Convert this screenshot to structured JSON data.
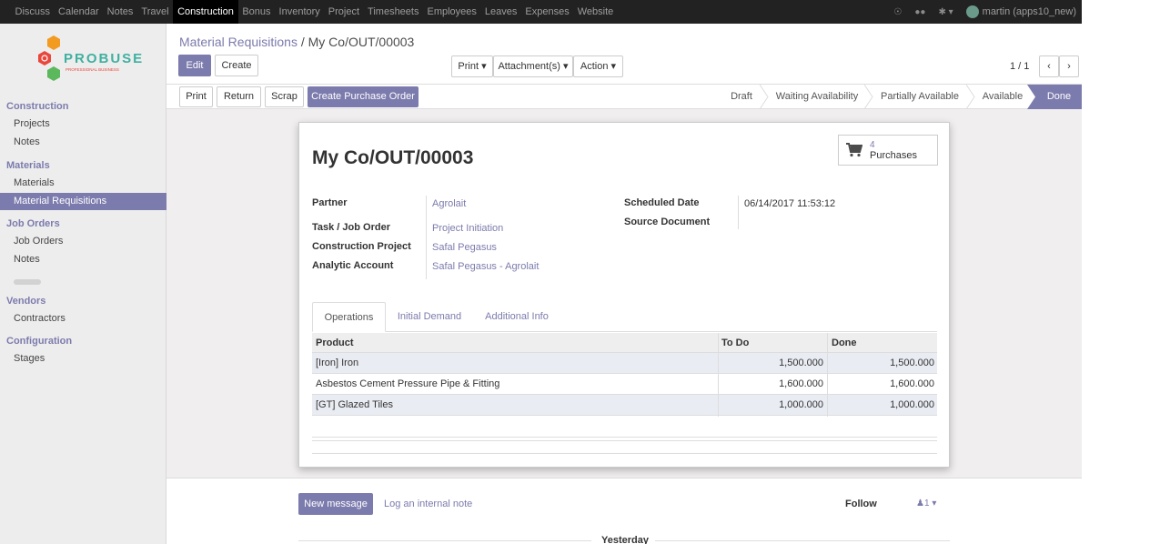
{
  "topbar": {
    "menus": [
      "Discuss",
      "Calendar",
      "Notes",
      "Travel",
      "Construction",
      "Bonus",
      "Inventory",
      "Project",
      "Timesheets",
      "Employees",
      "Leaves",
      "Expenses",
      "Website"
    ],
    "active_menu": "Construction",
    "user": "martin (apps10_new)"
  },
  "sidebar": {
    "logo_text": "PROBUSE",
    "logo_subtext": "PROFESSIONAL BUSINESS",
    "sections": [
      {
        "heading": "Construction",
        "items": [
          "Projects",
          "Notes"
        ]
      },
      {
        "heading": "Materials",
        "items": [
          "Materials",
          "Material Requisitions"
        ]
      },
      {
        "heading": "Job Orders",
        "items": [
          "Job Orders",
          "Notes"
        ]
      },
      {
        "heading": "Vendors",
        "items": [
          "Contractors"
        ]
      },
      {
        "heading": "Configuration",
        "items": [
          "Stages"
        ]
      }
    ],
    "active_item": "Material Requisitions"
  },
  "breadcrumb": {
    "parent": "Material Requisitions",
    "separator": "/",
    "current": "My Co/OUT/00003"
  },
  "toolbar": {
    "edit": "Edit",
    "create": "Create",
    "print": "Print",
    "attachments": "Attachment(s)",
    "action": "Action",
    "pager": "1 / 1"
  },
  "statusbar": {
    "buttons": [
      "Print",
      "Return",
      "Scrap",
      "Create Purchase Order"
    ],
    "stages": [
      "Draft",
      "Waiting Availability",
      "Partially Available",
      "Available",
      "Done"
    ],
    "active_stage": "Done"
  },
  "record": {
    "title": "My Co/OUT/00003",
    "smart_button": {
      "count": "4",
      "label": "Purchases"
    },
    "fields_left": [
      {
        "label": "Partner",
        "value": "Agrolait"
      },
      {
        "label": "Task / Job Order",
        "value": "Project Initiation"
      },
      {
        "label": "Construction Project",
        "value": "Safal Pegasus"
      },
      {
        "label": "Analytic Account",
        "value": "Safal Pegasus - Agrolait"
      }
    ],
    "fields_right": [
      {
        "label": "Scheduled Date",
        "value": "06/14/2017 11:53:12"
      },
      {
        "label": "Source Document",
        "value": ""
      }
    ]
  },
  "tabs": [
    "Operations",
    "Initial Demand",
    "Additional Info"
  ],
  "active_tab": "Operations",
  "operations": {
    "columns": [
      "Product",
      "To Do",
      "Done"
    ],
    "rows": [
      [
        "[Iron] Iron",
        "1,500.000",
        "1,500.000"
      ],
      [
        "Asbestos Cement Pressure Pipe & Fitting",
        "1,600.000",
        "1,600.000"
      ],
      [
        "[GT] Glazed Tiles",
        "1,000.000",
        "1,000.000"
      ]
    ]
  },
  "chatter": {
    "new_message": "New message",
    "log_note": "Log an internal note",
    "follow": "Follow",
    "followers": "1",
    "date_separator": "Yesterday"
  },
  "colors": {
    "accent": "#7c7bad",
    "topbar": "#222222"
  }
}
